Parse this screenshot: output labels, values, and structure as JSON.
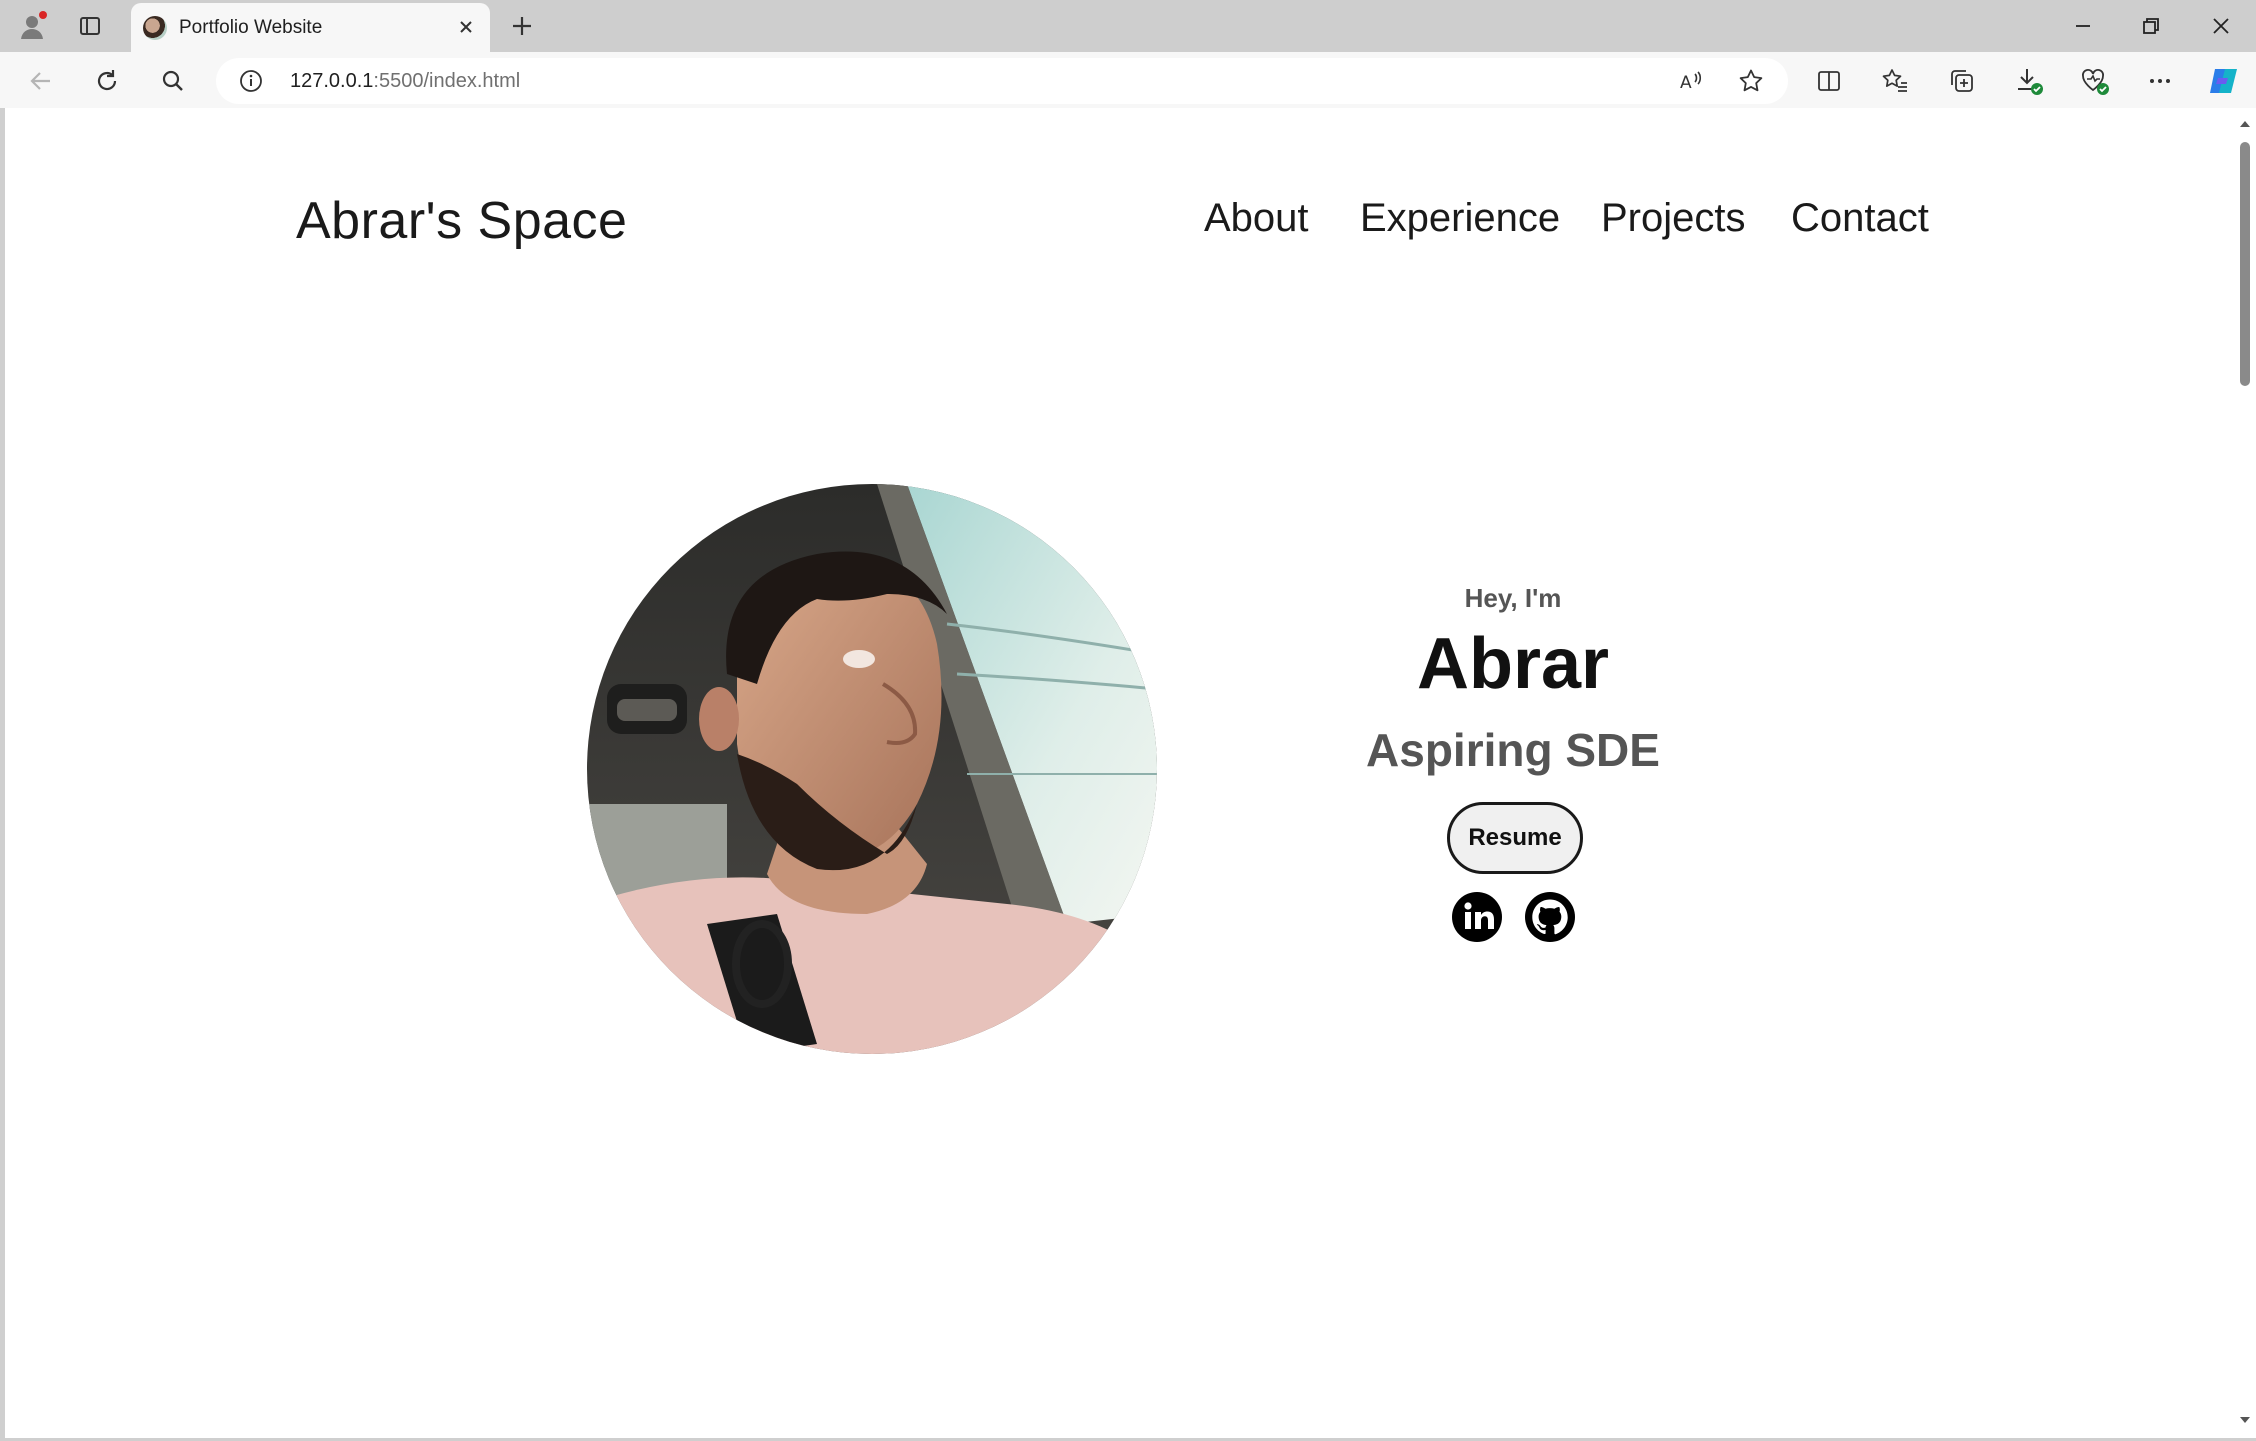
{
  "browser": {
    "tab_title": "Portfolio Website",
    "url_host": "127.0.0.1",
    "url_rest": ":5500/index.html"
  },
  "site": {
    "logo": "Abrar's Space",
    "nav": [
      "About",
      "Experience",
      "Projects",
      "Contact"
    ]
  },
  "hero": {
    "greeting": "Hey, I'm",
    "name": "Abrar",
    "role": "Aspiring SDE",
    "resume_label": "Resume",
    "social_icons": [
      "linkedin-icon",
      "github-icon"
    ]
  }
}
